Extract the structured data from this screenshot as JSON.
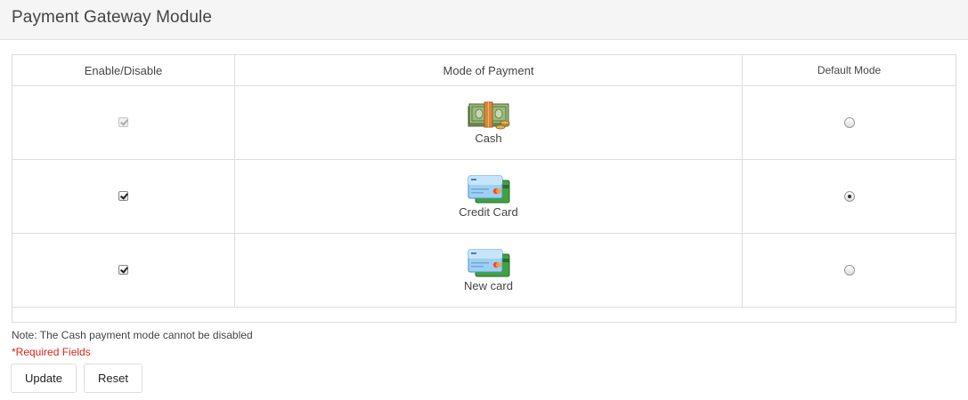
{
  "header": {
    "title": "Payment Gateway Module"
  },
  "table": {
    "columns": {
      "enable": "Enable/Disable",
      "mode": "Mode of Payment",
      "default": "Default Mode"
    },
    "rows": [
      {
        "label": "Cash",
        "icon": "cash-icon",
        "enabled": true,
        "enable_disabled": true,
        "default": false
      },
      {
        "label": "Credit Card",
        "icon": "credit-card-icon",
        "enabled": true,
        "enable_disabled": false,
        "default": true
      },
      {
        "label": "New card",
        "icon": "credit-card-icon",
        "enabled": true,
        "enable_disabled": false,
        "default": false
      }
    ]
  },
  "note": "Note: The Cash payment mode cannot be disabled",
  "required": "*Required Fields",
  "buttons": {
    "update": "Update",
    "reset": "Reset"
  },
  "colors": {
    "header_bg": "#f5f5f5",
    "border": "#dddddd",
    "required_red": "#d9251c"
  }
}
